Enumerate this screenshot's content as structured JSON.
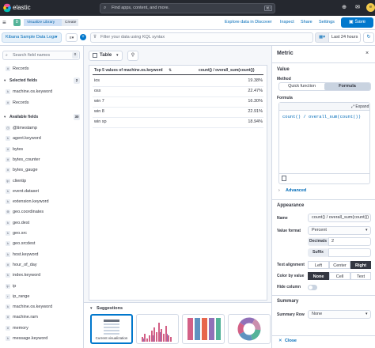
{
  "header": {
    "brand": "elastic",
    "search_placeholder": "Find apps, content, and more.",
    "search_shortcut": "⌘/",
    "avatar_initial": "e"
  },
  "nav": {
    "space_initial": "D",
    "breadcrumbs": [
      "Visualize Library",
      "Create"
    ],
    "links": [
      "Explore data in Discover",
      "Inspect",
      "Share",
      "Settings"
    ],
    "save_label": "Save"
  },
  "query": {
    "data_view": "Kibana Sample Data Logs",
    "placeholder": "Filter your data using KQL syntax",
    "date_range": "Last 24 hours"
  },
  "sidebar": {
    "search_placeholder": "Search field names",
    "filter_count": "0",
    "top_item": "Records",
    "selected_title": "Selected fields",
    "selected_count": "2",
    "selected": [
      {
        "name": "machine.os.keyword",
        "type": "k"
      },
      {
        "name": "Records",
        "type": "#"
      }
    ],
    "available_title": "Available fields",
    "available_count": "30",
    "available": [
      {
        "name": "@timestamp",
        "type": "◷"
      },
      {
        "name": "agent.keyword",
        "type": "k"
      },
      {
        "name": "bytes",
        "type": "#"
      },
      {
        "name": "bytes_counter",
        "type": "#"
      },
      {
        "name": "bytes_gauge",
        "type": "#"
      },
      {
        "name": "clientip",
        "type": "ip"
      },
      {
        "name": "event.dataset",
        "type": "k"
      },
      {
        "name": "extension.keyword",
        "type": "k"
      },
      {
        "name": "geo.coordinates",
        "type": "⊕"
      },
      {
        "name": "geo.dest",
        "type": "k"
      },
      {
        "name": "geo.src",
        "type": "k"
      },
      {
        "name": "geo.srcdest",
        "type": "k"
      },
      {
        "name": "host.keyword",
        "type": "k"
      },
      {
        "name": "hour_of_day",
        "type": "#"
      },
      {
        "name": "index.keyword",
        "type": "k"
      },
      {
        "name": "ip",
        "type": "ip"
      },
      {
        "name": "ip_range",
        "type": "r"
      },
      {
        "name": "machine.os.keyword",
        "type": "k"
      },
      {
        "name": "machine.ram",
        "type": "#"
      },
      {
        "name": "memory",
        "type": "#"
      },
      {
        "name": "message.keyword",
        "type": "k"
      }
    ]
  },
  "workspace": {
    "chart_type": "Table",
    "columns": [
      "Top 5 values of machine.os.keyword",
      "count() / overall_sum(count())"
    ],
    "rows": [
      [
        "ios",
        "19.38%"
      ],
      [
        "osx",
        "22.47%"
      ],
      [
        "win 7",
        "16.30%"
      ],
      [
        "win 8",
        "22.91%"
      ],
      [
        "win xp",
        "18.94%"
      ]
    ],
    "suggestions_title": "Suggestions",
    "current_label": "Current visualization"
  },
  "panel": {
    "title": "Metric",
    "value_header": "Value",
    "method_label": "Method",
    "method_options": [
      "Quick function",
      "Formula"
    ],
    "formula_label": "Formula",
    "expand_label": "Expand",
    "formula": "count() / overall_sum(count())",
    "advanced": "Advanced",
    "appearance": "Appearance",
    "name_label": "Name",
    "name_value": "count() / overall_sum(count())",
    "format_label": "Value format",
    "format_value": "Percent",
    "decimals_label": "Decimals",
    "decimals_value": "2",
    "suffix_label": "Suffix",
    "align_label": "Text alignment",
    "align_options": [
      "Left",
      "Center",
      "Right"
    ],
    "color_label": "Color by value",
    "color_options": [
      "None",
      "Cell",
      "Text"
    ],
    "hide_label": "Hide column",
    "summary_header": "Summary",
    "summary_row_label": "Summary Row",
    "summary_row_value": "None",
    "close": "Close"
  }
}
